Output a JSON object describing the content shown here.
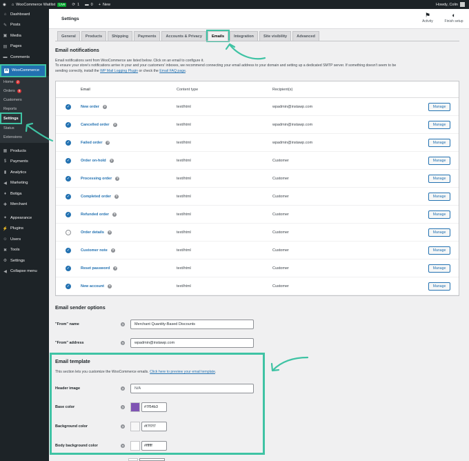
{
  "admin_bar": {
    "site_name": "WooCommerce Waitlist",
    "live_badge": "Live",
    "updates_count": "1",
    "comments_count": "0",
    "new_label": "New",
    "greeting": "Howdy, Colin"
  },
  "sidebar": {
    "items_top": [
      {
        "label": "Dashboard",
        "icon": "⌂"
      },
      {
        "label": "Posts",
        "icon": "✎"
      },
      {
        "label": "Media",
        "icon": "▣"
      },
      {
        "label": "Pages",
        "icon": "▤"
      },
      {
        "label": "Comments",
        "icon": "▬"
      }
    ],
    "woocommerce_label": "WooCommerce",
    "woocommerce_icon": "W",
    "submenu": [
      {
        "label": "Home",
        "badge": "2"
      },
      {
        "label": "Orders",
        "badge": "8"
      },
      {
        "label": "Customers",
        "badge": ""
      },
      {
        "label": "Reports",
        "badge": ""
      },
      {
        "label": "Settings",
        "badge": ""
      },
      {
        "label": "Status",
        "badge": ""
      },
      {
        "label": "Extensions",
        "badge": ""
      }
    ],
    "items_bottom": [
      {
        "label": "Products",
        "icon": "▦"
      },
      {
        "label": "Payments",
        "icon": "$"
      },
      {
        "label": "Analytics",
        "icon": "▮"
      },
      {
        "label": "Marketing",
        "icon": "◀"
      },
      {
        "label": "Botiga",
        "icon": "♦"
      },
      {
        "label": "Merchant",
        "icon": "✚"
      }
    ],
    "items_tools": [
      {
        "label": "Appearance",
        "icon": "✦"
      },
      {
        "label": "Plugins",
        "icon": "⚡"
      },
      {
        "label": "Users",
        "icon": "☺"
      },
      {
        "label": "Tools",
        "icon": "✖"
      },
      {
        "label": "Settings",
        "icon": "⚙"
      },
      {
        "label": "Collapse menu",
        "icon": "◀"
      }
    ]
  },
  "header": {
    "title": "Settings",
    "activity_label": "Activity",
    "finish_setup_label": "Finish setup"
  },
  "tabs": [
    "General",
    "Products",
    "Shipping",
    "Payments",
    "Accounts & Privacy",
    "Emails",
    "Integration",
    "Site visibility",
    "Advanced"
  ],
  "active_tab": "Emails",
  "notifications": {
    "heading": "Email notifications",
    "desc_line1": "Email notifications sent from WooCommerce are listed below. Click on an email to configure it.",
    "desc_line2": "To ensure your store's notifications arrive in your and your customers' inboxes, we recommend connecting your email address to your domain and setting up a dedicated SMTP server. If something doesn't seem to be",
    "desc_line3_a": "sending correctly, install the ",
    "desc_link1": "WP Mail Logging Plugin",
    "desc_line3_b": " or check the ",
    "desc_link2": "Email FAQ page",
    "desc_line3_c": ".",
    "columns": {
      "email": "Email",
      "content_type": "Content type",
      "recipients": "Recipient(s)"
    },
    "manage_label": "Manage",
    "rows": [
      {
        "name": "New order",
        "type": "text/html",
        "recipient": "wpadmin@instawp.com",
        "enabled": true
      },
      {
        "name": "Cancelled order",
        "type": "text/html",
        "recipient": "wpadmin@instawp.com",
        "enabled": true
      },
      {
        "name": "Failed order",
        "type": "text/html",
        "recipient": "wpadmin@instawp.com",
        "enabled": true
      },
      {
        "name": "Order on-hold",
        "type": "text/html",
        "recipient": "Customer",
        "enabled": true
      },
      {
        "name": "Processing order",
        "type": "text/html",
        "recipient": "Customer",
        "enabled": true
      },
      {
        "name": "Completed order",
        "type": "text/html",
        "recipient": "Customer",
        "enabled": true
      },
      {
        "name": "Refunded order",
        "type": "text/html",
        "recipient": "Customer",
        "enabled": true
      },
      {
        "name": "Order details",
        "type": "text/html",
        "recipient": "Customer",
        "enabled": false
      },
      {
        "name": "Customer note",
        "type": "text/html",
        "recipient": "Customer",
        "enabled": true
      },
      {
        "name": "Reset password",
        "type": "text/html",
        "recipient": "Customer",
        "enabled": true
      },
      {
        "name": "New account",
        "type": "text/html",
        "recipient": "Customer",
        "enabled": true
      }
    ]
  },
  "sender": {
    "heading": "Email sender options",
    "from_name_label": "\"From\" name",
    "from_name_value": "Merchant Quantity-Based Discounts",
    "from_address_label": "\"From\" address",
    "from_address_value": "wpadmin@instawp.com"
  },
  "template": {
    "heading": "Email template",
    "desc_a": "This section lets you customize the WooCommerce emails. ",
    "desc_link": "Click here to preview your email template",
    "desc_b": ".",
    "header_image_label": "Header image",
    "header_image_value": "N/A",
    "base_color_label": "Base color",
    "base_color_value": "#7f54b3",
    "background_color_label": "Background color",
    "background_color_value": "#f7f7f7",
    "body_background_label": "Body background color",
    "body_background_value": "#ffffff"
  },
  "colors": {
    "accent": "#2271b1",
    "highlight": "#3fc3a4",
    "sidebar_bg": "#1d2327"
  }
}
